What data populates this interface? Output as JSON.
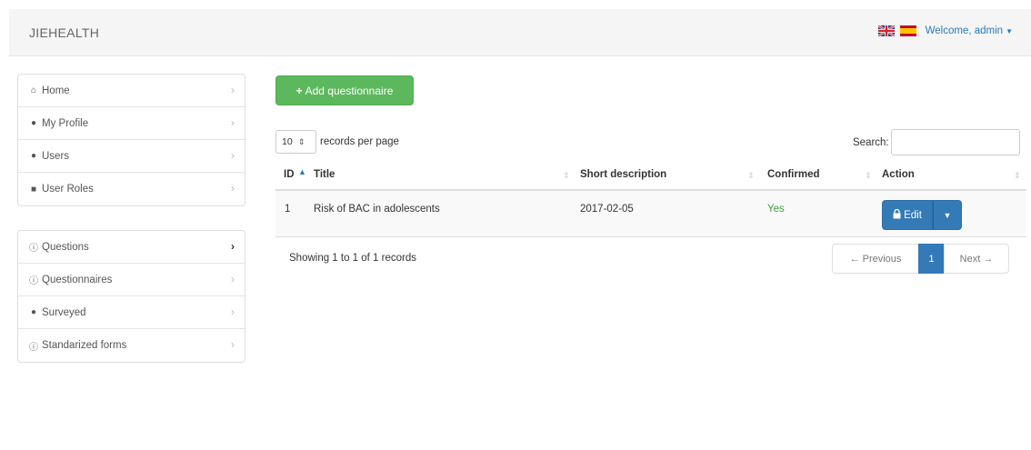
{
  "navbar": {
    "brand": "JIEHEALTH",
    "welcome": "Welcome, admin",
    "flags": [
      "uk-flag-icon",
      "spain-flag-icon"
    ]
  },
  "sidebar": {
    "group1": [
      {
        "label": "Home",
        "icon": "home-icon"
      },
      {
        "label": "My Profile",
        "icon": "user-icon"
      },
      {
        "label": "Users",
        "icon": "users-icon"
      },
      {
        "label": "User Roles",
        "icon": "lock-icon"
      }
    ],
    "group2": [
      {
        "label": "Questions",
        "icon": "question-circle-icon",
        "active": true
      },
      {
        "label": "Questionnaires",
        "icon": "question-circle-icon"
      },
      {
        "label": "Surveyed",
        "icon": "users-icon"
      },
      {
        "label": "Standarized forms",
        "icon": "question-circle-icon"
      }
    ]
  },
  "toolbar": {
    "add_label": "Add questionnaire"
  },
  "table_controls": {
    "page_size": "10",
    "records_per_page": "records per page",
    "search_label": "Search:",
    "search_value": ""
  },
  "table": {
    "headers": [
      "ID",
      "Title",
      "Short description",
      "Confirmed",
      "Action"
    ],
    "rows": [
      {
        "id": "1",
        "title": "Risk of BAC in adolescents",
        "short_description": "2017-02-05",
        "confirmed": "Yes",
        "action": "Edit"
      }
    ]
  },
  "footer": {
    "info": "Showing 1 to 1 of 1 records",
    "previous": "← Previous",
    "page": "1",
    "next": "Next →"
  },
  "colors": {
    "primary": "#337ab7",
    "success": "#5cb85c",
    "yes_text": "#3c9f3c"
  }
}
